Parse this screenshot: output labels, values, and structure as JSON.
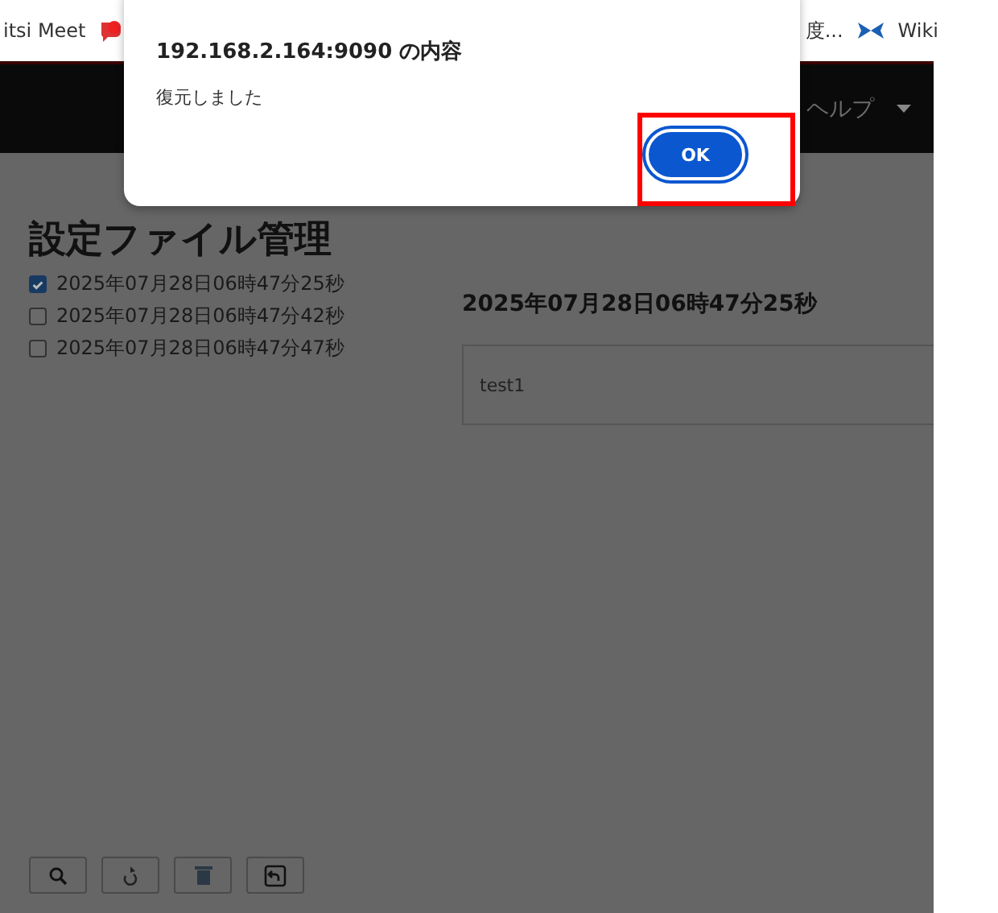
{
  "bookmarks": [
    {
      "label": "itsi Meet"
    },
    {
      "label": "度..."
    },
    {
      "label": "Wiki"
    }
  ],
  "navbar": {
    "menu": "ヘルプ"
  },
  "page": {
    "title": "設定ファイル管理",
    "files": [
      {
        "label": "2025年07月28日06時47分25秒",
        "checked": true
      },
      {
        "label": "2025年07月28日06時47分42秒",
        "checked": false
      },
      {
        "label": "2025年07月28日06時47分47秒",
        "checked": false
      }
    ],
    "detail": {
      "title": "2025年07月28日06時47分25秒",
      "content": "test1"
    }
  },
  "dialog": {
    "title": "192.168.2.164:9090 の内容",
    "message": "復元しました",
    "button": "OK",
    "highlighted": true
  }
}
